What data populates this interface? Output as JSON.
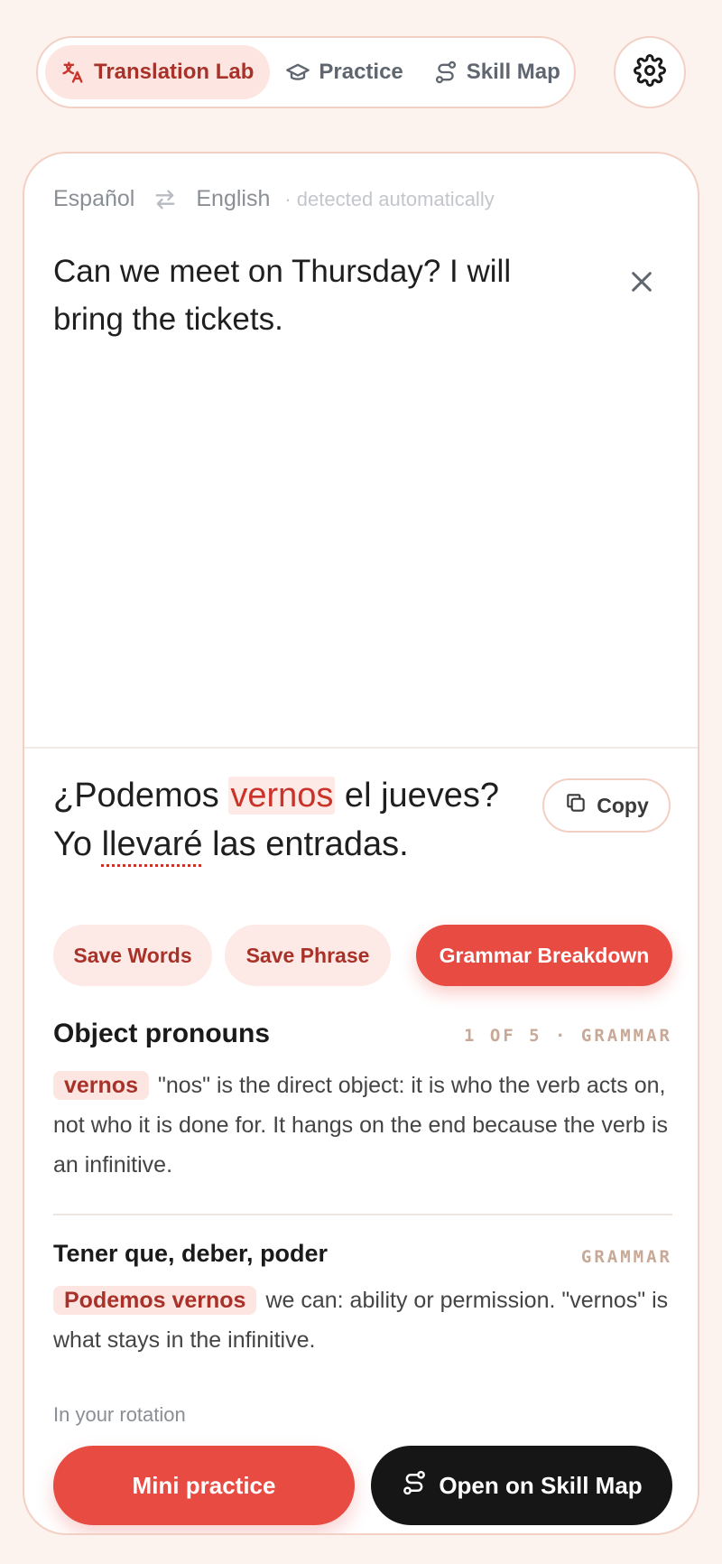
{
  "nav": {
    "items": [
      {
        "label": "Translation Lab",
        "icon": "translate-icon"
      },
      {
        "label": "Practice",
        "icon": "graduation-cap-icon"
      },
      {
        "label": "Skill Map",
        "icon": "route-icon"
      }
    ],
    "settings_icon": "gear-icon"
  },
  "languages": {
    "source": "Español",
    "target": "English",
    "detected": "· detected automatically"
  },
  "source_text": "Can we meet on Thursday? I will bring the tickets.",
  "translation": {
    "part1": "¿Podemos ",
    "highlight": "vernos",
    "part2": " el jueves? Yo ",
    "underlined": "llevaré",
    "part3": " las entradas."
  },
  "copy_label": "Copy",
  "actions": {
    "save_words": "Save Words",
    "save_phrase": "Save Phrase",
    "grammar": "Grammar Breakdown"
  },
  "sections": [
    {
      "title": "Object pronouns",
      "meta": "1 OF 5 · GRAMMAR",
      "tag": "vernos",
      "body": "\"nos\" is the direct object: it is who the verb acts on, not who it is done for. It hangs on the end because the verb is an infinitive."
    },
    {
      "title": "Tener que, deber, poder",
      "meta": "GRAMMAR",
      "tag": "Podemos vernos",
      "body": "we can: ability or permission. \"vernos\" is what stays in the infinitive."
    }
  ],
  "rotation_note": "In your rotation",
  "bottom": {
    "mini_practice": "Mini practice",
    "open_map": "Open on Skill Map"
  },
  "colors": {
    "accent": "#e84b42",
    "accent_dark": "#a83229",
    "background": "#fdf3ee"
  }
}
